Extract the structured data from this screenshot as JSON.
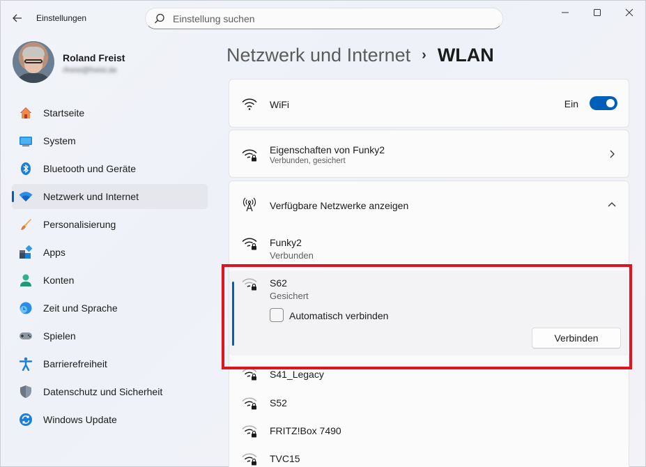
{
  "app": {
    "title": "Einstellungen"
  },
  "search": {
    "placeholder": "Einstellung suchen"
  },
  "profile": {
    "name": "Roland Freist",
    "email": "rfreist@freist.de"
  },
  "sidebar": {
    "items": [
      {
        "label": "Startseite",
        "icon": "home-icon"
      },
      {
        "label": "System",
        "icon": "monitor-icon"
      },
      {
        "label": "Bluetooth und Geräte",
        "icon": "bluetooth-icon"
      },
      {
        "label": "Netzwerk und Internet",
        "icon": "network-icon",
        "active": true
      },
      {
        "label": "Personalisierung",
        "icon": "brush-icon"
      },
      {
        "label": "Apps",
        "icon": "apps-icon"
      },
      {
        "label": "Konten",
        "icon": "account-icon"
      },
      {
        "label": "Zeit und Sprache",
        "icon": "clock-globe-icon"
      },
      {
        "label": "Spielen",
        "icon": "gamepad-icon"
      },
      {
        "label": "Barrierefreiheit",
        "icon": "accessibility-icon"
      },
      {
        "label": "Datenschutz und Sicherheit",
        "icon": "shield-icon"
      },
      {
        "label": "Windows Update",
        "icon": "update-icon"
      }
    ]
  },
  "breadcrumb": {
    "parent": "Netzwerk und Internet",
    "separator": "›",
    "current": "WLAN"
  },
  "wifi": {
    "label": "WiFi",
    "state": "Ein",
    "enabled": true
  },
  "properties": {
    "title": "Eigenschaften von Funky2",
    "subtitle": "Verbunden, gesichert"
  },
  "available": {
    "label": "Verfügbare Netzwerke anzeigen"
  },
  "networks": [
    {
      "ssid": "Funky2",
      "status": "Verbunden"
    },
    {
      "ssid": "S62",
      "status": "Gesichert",
      "auto_connect_label": "Automatisch verbinden",
      "auto_connect": false,
      "connect_label": "Verbinden"
    },
    {
      "ssid": "S41_Legacy"
    },
    {
      "ssid": "S52"
    },
    {
      "ssid": "FRITZ!Box 7490"
    },
    {
      "ssid": "TVC15"
    }
  ],
  "colors": {
    "accent": "#005fb8",
    "highlight": "#e0141e"
  }
}
